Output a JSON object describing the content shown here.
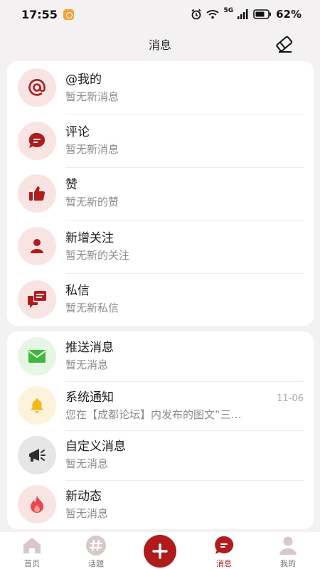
{
  "status_bar": {
    "time": "17:55",
    "signal": "5G",
    "battery": "62%"
  },
  "header": {
    "title": "消息"
  },
  "card1": [
    {
      "title": "@我的",
      "subtitle": "暂无新消息",
      "icon": "at-icon"
    },
    {
      "title": "评论",
      "subtitle": "暂无新消息",
      "icon": "comment-icon"
    },
    {
      "title": "赞",
      "subtitle": "暂无新的赞",
      "icon": "thumbs-up-icon"
    },
    {
      "title": "新增关注",
      "subtitle": "暂无新的关注",
      "icon": "person-icon"
    },
    {
      "title": "私信",
      "subtitle": "暂无新私信",
      "icon": "private-message-icon"
    }
  ],
  "card2": [
    {
      "title": "推送消息",
      "subtitle": "暂无消息",
      "time": "",
      "icon": "envelope-icon"
    },
    {
      "title": "系统通知",
      "subtitle": "您在【成都论坛】内发布的图文“三…",
      "time": "11-06",
      "icon": "bell-icon"
    },
    {
      "title": "自定义消息",
      "subtitle": "暂无消息",
      "time": "",
      "icon": "megaphone-icon"
    },
    {
      "title": "新动态",
      "subtitle": "暂无消息",
      "time": "",
      "icon": "flame-icon"
    }
  ],
  "bottom_nav": [
    {
      "label": "首页",
      "icon": "home-icon",
      "active": false
    },
    {
      "label": "话题",
      "icon": "hashtag-icon",
      "active": false
    },
    {
      "label": "",
      "icon": "plus-icon",
      "active": false
    },
    {
      "label": "消息",
      "icon": "message-icon",
      "active": true
    },
    {
      "label": "我的",
      "icon": "profile-icon",
      "active": false
    }
  ],
  "colors": {
    "accent": "#b01b1b",
    "pink_bg": "#f9e4e4",
    "green": "#3cb83c",
    "yellow": "#f3b81a"
  }
}
